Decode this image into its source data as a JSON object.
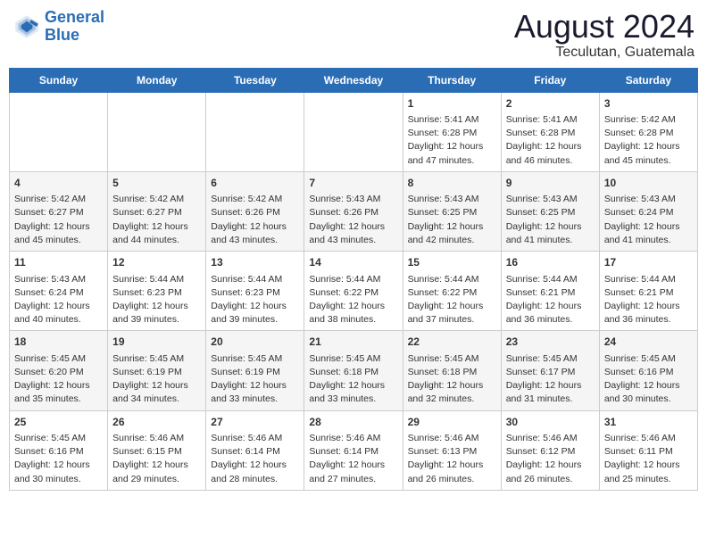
{
  "header": {
    "logo_line1": "General",
    "logo_line2": "Blue",
    "title": "August 2024",
    "subtitle": "Teculutan, Guatemala"
  },
  "days_of_week": [
    "Sunday",
    "Monday",
    "Tuesday",
    "Wednesday",
    "Thursday",
    "Friday",
    "Saturday"
  ],
  "weeks": [
    [
      {
        "num": "",
        "info": ""
      },
      {
        "num": "",
        "info": ""
      },
      {
        "num": "",
        "info": ""
      },
      {
        "num": "",
        "info": ""
      },
      {
        "num": "1",
        "info": "Sunrise: 5:41 AM\nSunset: 6:28 PM\nDaylight: 12 hours and 47 minutes."
      },
      {
        "num": "2",
        "info": "Sunrise: 5:41 AM\nSunset: 6:28 PM\nDaylight: 12 hours and 46 minutes."
      },
      {
        "num": "3",
        "info": "Sunrise: 5:42 AM\nSunset: 6:28 PM\nDaylight: 12 hours and 45 minutes."
      }
    ],
    [
      {
        "num": "4",
        "info": "Sunrise: 5:42 AM\nSunset: 6:27 PM\nDaylight: 12 hours and 45 minutes."
      },
      {
        "num": "5",
        "info": "Sunrise: 5:42 AM\nSunset: 6:27 PM\nDaylight: 12 hours and 44 minutes."
      },
      {
        "num": "6",
        "info": "Sunrise: 5:42 AM\nSunset: 6:26 PM\nDaylight: 12 hours and 43 minutes."
      },
      {
        "num": "7",
        "info": "Sunrise: 5:43 AM\nSunset: 6:26 PM\nDaylight: 12 hours and 43 minutes."
      },
      {
        "num": "8",
        "info": "Sunrise: 5:43 AM\nSunset: 6:25 PM\nDaylight: 12 hours and 42 minutes."
      },
      {
        "num": "9",
        "info": "Sunrise: 5:43 AM\nSunset: 6:25 PM\nDaylight: 12 hours and 41 minutes."
      },
      {
        "num": "10",
        "info": "Sunrise: 5:43 AM\nSunset: 6:24 PM\nDaylight: 12 hours and 41 minutes."
      }
    ],
    [
      {
        "num": "11",
        "info": "Sunrise: 5:43 AM\nSunset: 6:24 PM\nDaylight: 12 hours and 40 minutes."
      },
      {
        "num": "12",
        "info": "Sunrise: 5:44 AM\nSunset: 6:23 PM\nDaylight: 12 hours and 39 minutes."
      },
      {
        "num": "13",
        "info": "Sunrise: 5:44 AM\nSunset: 6:23 PM\nDaylight: 12 hours and 39 minutes."
      },
      {
        "num": "14",
        "info": "Sunrise: 5:44 AM\nSunset: 6:22 PM\nDaylight: 12 hours and 38 minutes."
      },
      {
        "num": "15",
        "info": "Sunrise: 5:44 AM\nSunset: 6:22 PM\nDaylight: 12 hours and 37 minutes."
      },
      {
        "num": "16",
        "info": "Sunrise: 5:44 AM\nSunset: 6:21 PM\nDaylight: 12 hours and 36 minutes."
      },
      {
        "num": "17",
        "info": "Sunrise: 5:44 AM\nSunset: 6:21 PM\nDaylight: 12 hours and 36 minutes."
      }
    ],
    [
      {
        "num": "18",
        "info": "Sunrise: 5:45 AM\nSunset: 6:20 PM\nDaylight: 12 hours and 35 minutes."
      },
      {
        "num": "19",
        "info": "Sunrise: 5:45 AM\nSunset: 6:19 PM\nDaylight: 12 hours and 34 minutes."
      },
      {
        "num": "20",
        "info": "Sunrise: 5:45 AM\nSunset: 6:19 PM\nDaylight: 12 hours and 33 minutes."
      },
      {
        "num": "21",
        "info": "Sunrise: 5:45 AM\nSunset: 6:18 PM\nDaylight: 12 hours and 33 minutes."
      },
      {
        "num": "22",
        "info": "Sunrise: 5:45 AM\nSunset: 6:18 PM\nDaylight: 12 hours and 32 minutes."
      },
      {
        "num": "23",
        "info": "Sunrise: 5:45 AM\nSunset: 6:17 PM\nDaylight: 12 hours and 31 minutes."
      },
      {
        "num": "24",
        "info": "Sunrise: 5:45 AM\nSunset: 6:16 PM\nDaylight: 12 hours and 30 minutes."
      }
    ],
    [
      {
        "num": "25",
        "info": "Sunrise: 5:45 AM\nSunset: 6:16 PM\nDaylight: 12 hours and 30 minutes."
      },
      {
        "num": "26",
        "info": "Sunrise: 5:46 AM\nSunset: 6:15 PM\nDaylight: 12 hours and 29 minutes."
      },
      {
        "num": "27",
        "info": "Sunrise: 5:46 AM\nSunset: 6:14 PM\nDaylight: 12 hours and 28 minutes."
      },
      {
        "num": "28",
        "info": "Sunrise: 5:46 AM\nSunset: 6:14 PM\nDaylight: 12 hours and 27 minutes."
      },
      {
        "num": "29",
        "info": "Sunrise: 5:46 AM\nSunset: 6:13 PM\nDaylight: 12 hours and 26 minutes."
      },
      {
        "num": "30",
        "info": "Sunrise: 5:46 AM\nSunset: 6:12 PM\nDaylight: 12 hours and 26 minutes."
      },
      {
        "num": "31",
        "info": "Sunrise: 5:46 AM\nSunset: 6:11 PM\nDaylight: 12 hours and 25 minutes."
      }
    ]
  ]
}
